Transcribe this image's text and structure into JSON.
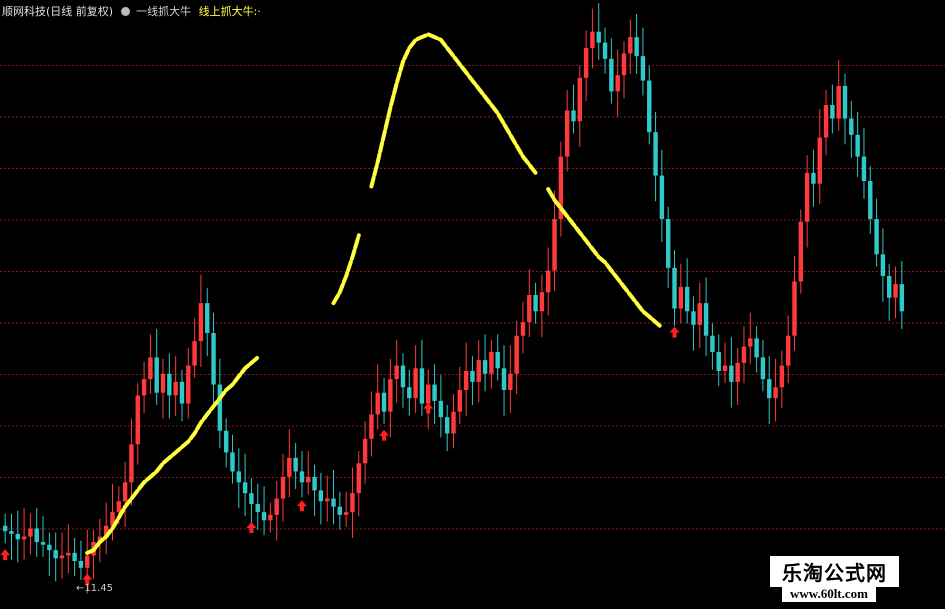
{
  "header": {
    "stock_name": "顺网科技(日线 前复权)",
    "indicator_name": "一线抓大牛",
    "signal_label": "线上抓大牛:·"
  },
  "low_label": "←11.45",
  "watermark": {
    "title": "乐淘公式网",
    "url": "www.60lt.com"
  },
  "colors": {
    "up": "#ff3a3a",
    "down": "#30c8c8",
    "line": "#ffff40",
    "grid": "#8b1a1a",
    "arrow": "#ff2020"
  },
  "chart_data": {
    "type": "candlestick",
    "ylim": [
      11.0,
      32.0
    ],
    "grid": true,
    "low_marker": 11.45,
    "closes": [
      12.8,
      12.7,
      12.5,
      12.6,
      12.9,
      12.4,
      12.3,
      12.1,
      11.8,
      11.9,
      12.0,
      11.7,
      11.45,
      11.9,
      12.4,
      12.6,
      13.0,
      13.5,
      13.9,
      14.6,
      16.0,
      17.8,
      18.4,
      19.2,
      17.9,
      18.6,
      17.8,
      18.3,
      17.5,
      18.9,
      19.8,
      21.2,
      20.1,
      18.2,
      16.5,
      15.7,
      15.0,
      14.6,
      14.2,
      13.8,
      13.5,
      13.2,
      13.4,
      14.0,
      14.8,
      15.5,
      15.0,
      14.6,
      14.8,
      14.3,
      13.9,
      14.0,
      13.7,
      13.4,
      13.5,
      14.2,
      15.3,
      16.2,
      17.1,
      17.9,
      17.2,
      18.4,
      18.9,
      18.1,
      17.7,
      18.8,
      17.5,
      18.2,
      17.6,
      17.0,
      16.4,
      17.2,
      18.0,
      18.7,
      18.3,
      19.1,
      18.6,
      19.4,
      18.8,
      18.0,
      18.6,
      20.0,
      20.5,
      21.5,
      20.9,
      21.6,
      22.4,
      24.3,
      26.6,
      28.3,
      27.9,
      29.5,
      30.6,
      31.2,
      30.8,
      30.2,
      29.0,
      29.6,
      30.4,
      31.0,
      30.3,
      29.4,
      27.5,
      25.9,
      24.3,
      22.5,
      21.0,
      21.8,
      20.9,
      20.4,
      21.2,
      20.0,
      19.4,
      18.7,
      18.9,
      18.3,
      19.0,
      19.6,
      19.9,
      19.2,
      18.4,
      17.7,
      18.1,
      18.9,
      20.0,
      22.0,
      24.2,
      26.0,
      25.6,
      27.3,
      28.5,
      28.0,
      29.2,
      28.0,
      27.4,
      26.6,
      25.7,
      24.3,
      23.0,
      22.2,
      21.4,
      21.9,
      20.9
    ],
    "signal_line": {
      "segments": [
        [
          13,
          40
        ],
        [
          52,
          56
        ],
        [
          58,
          84
        ],
        [
          86,
          104
        ]
      ],
      "values": [
        12.0,
        12.1,
        12.4,
        12.6,
        12.9,
        13.3,
        13.7,
        14.0,
        14.3,
        14.6,
        14.8,
        15.0,
        15.3,
        15.5,
        15.7,
        15.9,
        16.1,
        16.4,
        16.8,
        17.1,
        17.4,
        17.7,
        18.0,
        18.2,
        18.5,
        18.8,
        19.0,
        19.2,
        19.4,
        19.6,
        19.7,
        19.8,
        19.9,
        20.0,
        20.0,
        20.1,
        20.3,
        20.5,
        20.8,
        21.2,
        21.6,
        22.2,
        22.9,
        23.7,
        24.6,
        25.5,
        26.4,
        27.4,
        28.4,
        29.3,
        30.1,
        30.6,
        30.9,
        31.0,
        31.1,
        31.0,
        30.9,
        30.6,
        30.3,
        30.0,
        29.7,
        29.4,
        29.1,
        28.8,
        28.5,
        28.2,
        27.8,
        27.4,
        27.0,
        26.6,
        26.3,
        26.0,
        25.7,
        25.4,
        25.0,
        24.7,
        24.4,
        24.1,
        23.8,
        23.5,
        23.2,
        22.9,
        22.7,
        22.4,
        22.1,
        21.8,
        21.5,
        21.2,
        20.9,
        20.7,
        20.5,
        20.3,
        20.0,
        19.7,
        19.5,
        19.2,
        19.0,
        18.8,
        18.5,
        18.3,
        18.1,
        18.6,
        19.2,
        19.9,
        20.6,
        21.4,
        22.2,
        23.0,
        23.8,
        24.5,
        25.1,
        25.6,
        26.0,
        26.2,
        26.4,
        26.5,
        26.5,
        26.3,
        26.1,
        25.8,
        25.5,
        25.2,
        24.9,
        24.6,
        24.3,
        24.0,
        23.7,
        23.4,
        23.1,
        22.8,
        22.5,
        22.2,
        21.9,
        21.7,
        21.5,
        21.3,
        21.1,
        20.9
      ]
    },
    "buy_signals": [
      0,
      13,
      39,
      47,
      60,
      67,
      106
    ]
  }
}
